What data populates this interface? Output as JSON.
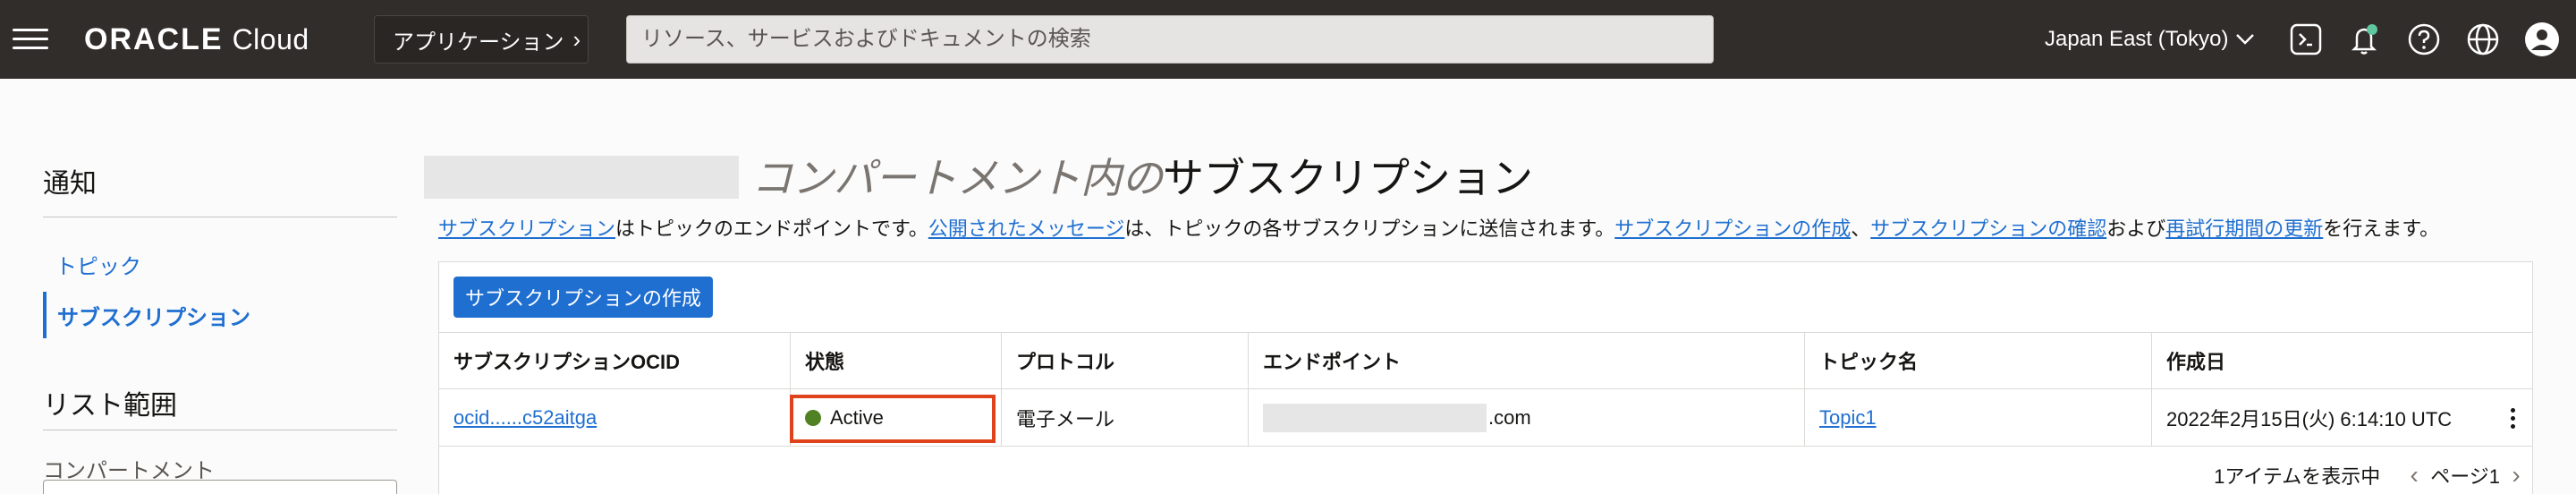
{
  "header": {
    "brand": "ORACLE",
    "product": "Cloud",
    "apps_label": "アプリケーション",
    "search_placeholder": "リソース、サービスおよびドキュメントの検索",
    "region": "Japan East (Tokyo)",
    "icons": [
      "menu-icon",
      "cloud-shell-icon",
      "bell-icon",
      "help-icon",
      "globe-icon",
      "user-icon"
    ],
    "notification_dot_color": "#5fc7a0"
  },
  "sidebar": {
    "title": "通知",
    "items": [
      {
        "label": "トピック",
        "active": false
      },
      {
        "label": "サブスクリプション",
        "active": true
      }
    ],
    "scope_title": "リスト範囲",
    "compartment_label": "コンパートメント"
  },
  "main": {
    "title_prefix": "コンパートメント内の",
    "title": "サブスクリプション",
    "desc": {
      "link1": "サブスクリプション",
      "text1": "はトピックのエンドポイントです。",
      "link2": "公開されたメッセージ",
      "text2": "は、トピックの各サブスクリプションに送信されます。",
      "link3": "サブスクリプションの作成",
      "text3": "、",
      "link4": "サブスクリプションの確認",
      "text4": "および",
      "link5": "再試行期間の更新",
      "text5": "を行えます。"
    },
    "create_button": "サブスクリプションの作成",
    "table": {
      "columns": [
        "サブスクリプションOCID",
        "状態",
        "プロトコル",
        "エンドポイント",
        "トピック名",
        "作成日"
      ],
      "rows": [
        {
          "ocid": "ocid......c52aitga",
          "status": "Active",
          "protocol": "電子メール",
          "endpoint_suffix": ".com",
          "topic": "Topic1",
          "created": "2022年2月15日(火) 6:14:10 UTC"
        }
      ]
    },
    "pager": {
      "summary": "1アイテムを表示中",
      "page": "ページ1"
    }
  },
  "colors": {
    "topbar": "#312d2a",
    "link": "#1f6fd1",
    "active_status": "#508223",
    "highlight": "#e0431b"
  }
}
